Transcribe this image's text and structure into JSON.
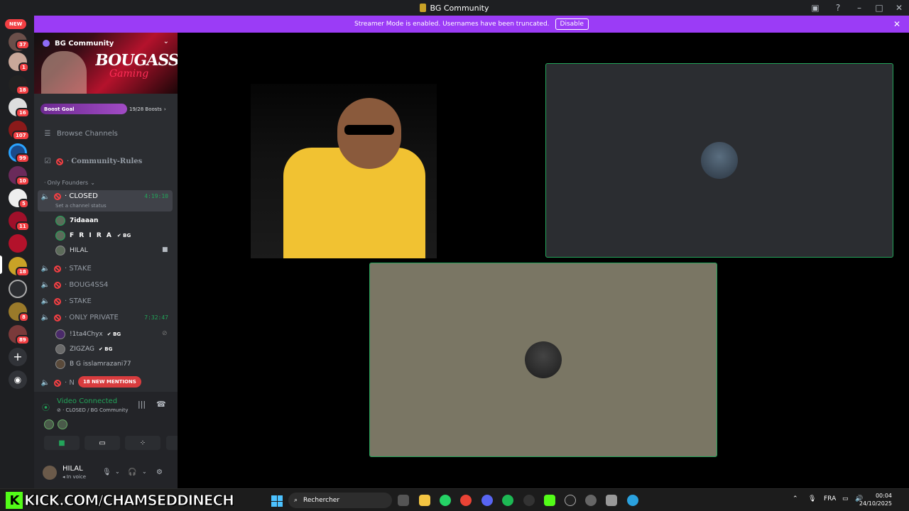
{
  "window": {
    "title": "BG Community"
  },
  "banner": {
    "text": "Streamer Mode is enabled. Usernames have been truncated.",
    "disable_label": "Disable"
  },
  "rail": {
    "new_label": "NEW",
    "badges": [
      "37",
      "1",
      "18",
      "16",
      "107",
      "99",
      "10",
      "5",
      "11",
      "18",
      "8",
      "89"
    ]
  },
  "server": {
    "name": "BG Community",
    "art_text": "BOUGASSAA",
    "art_sub": "Gaming",
    "boost_label": "Boost Goal",
    "boost_count": "19/28 Boosts",
    "boost_progress": 0.68,
    "browse_label": "Browse Channels"
  },
  "channels": {
    "rules": "Community-Rules",
    "category": "Only Founders",
    "closed": {
      "name": "CLOSED",
      "timer": "4:19:10",
      "status": "Set a channel status"
    },
    "closed_users": [
      {
        "name": "7idaaan",
        "tag": ""
      },
      {
        "name": "F R I R A",
        "tag": "BG"
      },
      {
        "name": "HILAL",
        "tag": ""
      }
    ],
    "stake1": "STAKE",
    "boug": "BOUG4SS4",
    "stake2": "STAKE",
    "private": {
      "name": "ONLY PRIVATE",
      "timer": "7:32:47"
    },
    "private_users": [
      {
        "name": "!1ta4Chyx",
        "tag": "BG"
      },
      {
        "name": "ZIGZAG",
        "tag": "BG"
      },
      {
        "name": "B G isslamrazani77",
        "tag": ""
      }
    ],
    "partial": "N",
    "mentions": "18 NEW MENTIONS"
  },
  "voice": {
    "title": "Video Connected",
    "subtitle": "CLOSED / BG Community"
  },
  "user": {
    "name": "HILAL",
    "status": "In voice"
  },
  "taskbar": {
    "kick_text": "KICK.COM/CHAMSEDDINECH",
    "search_placeholder": "Rechercher",
    "lang": "FRA",
    "time": "00:04",
    "date": "24/10/2025"
  },
  "colors": {
    "accent": "#9b3cf6",
    "online": "#23a55a",
    "danger": "#f23f43"
  }
}
